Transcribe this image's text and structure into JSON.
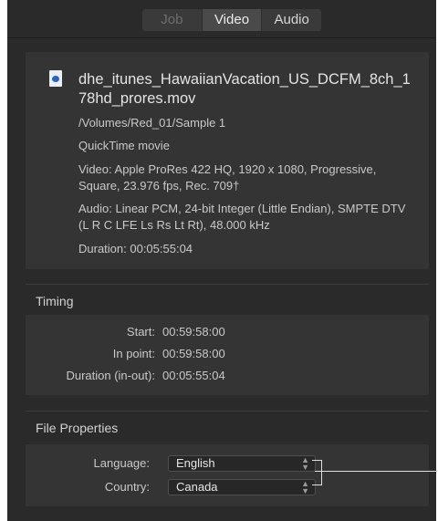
{
  "tabs": [
    {
      "label": "Job"
    },
    {
      "label": "Video"
    },
    {
      "label": "Audio"
    }
  ],
  "file": {
    "name": "dhe_itunes_HawaiianVacation_US_DCFM_8ch_178hd_prores.mov",
    "path": "/Volumes/Red_01/Sample 1",
    "type": "QuickTime movie",
    "video": "Video: Apple ProRes 422 HQ, 1920 x 1080, Progressive, Square, 23.976 fps, Rec. 709†",
    "audio": "Audio: Linear PCM, 24-bit Integer (Little Endian), SMPTE DTV (L R C LFE Ls Rs Lt Rt), 48.000 kHz",
    "duration": "Duration: 00:05:55:04"
  },
  "timing": {
    "title": "Timing",
    "rows": [
      {
        "label": "Start:",
        "value": "00:59:58:00"
      },
      {
        "label": "In point:",
        "value": "00:59:58:00"
      },
      {
        "label": "Duration (in-out):",
        "value": "00:05:55:04"
      }
    ]
  },
  "file_properties": {
    "title": "File Properties",
    "language": {
      "label": "Language:",
      "value": "English"
    },
    "country": {
      "label": "Country:",
      "value": "Canada"
    }
  }
}
